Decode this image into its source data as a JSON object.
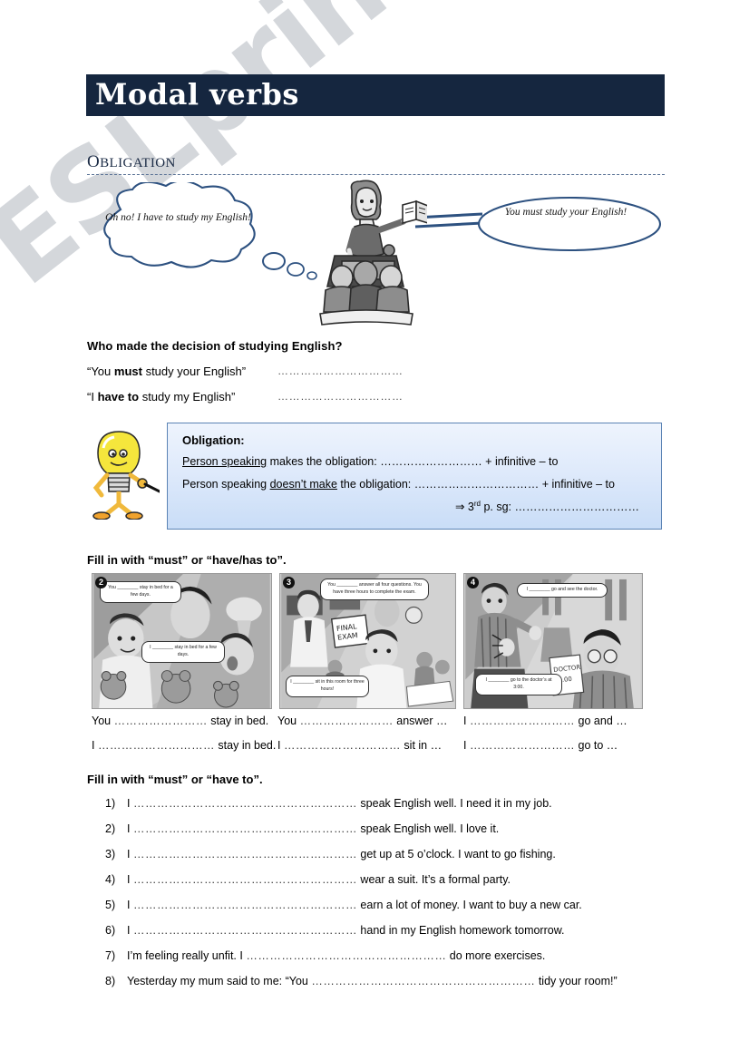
{
  "document": {
    "title": "Modal verbs",
    "watermark": "ESLprintables.com",
    "section_label_first": "O",
    "section_label_rest": "BLIGATION"
  },
  "illustration": {
    "thought_bubble": "Oh no! I have to study my English!",
    "speech_bubble": "You must study your English!",
    "teacher_icon": "teacher-with-book",
    "students_icon": "students-at-desk"
  },
  "question_block": {
    "heading": "Who made the decision of studying English?",
    "rows": [
      {
        "quote_pre": "“You ",
        "quote_bold": "must",
        "quote_post": " study your English”",
        "dots": "……………………………"
      },
      {
        "quote_pre": "“I ",
        "quote_bold": "have to",
        "quote_post": " study my English”",
        "dots": "……………………………"
      }
    ]
  },
  "obligation_box": {
    "icon": "lightbulb-character-with-pointer",
    "heading": "Obligation:",
    "line1_underline": "Person speaking",
    "line1_rest": " makes the obligation: ",
    "line1_dots": "………………………",
    "line1_tail": " + infinitive – to",
    "line2_pre": "Person speaking ",
    "line2_underline": "doesn’t make",
    "line2_rest": " the obligation: ",
    "line2_dots": "……………………………",
    "line2_tail": " + infinitive – to",
    "line3_arrow": "⇒ 3",
    "line3_sup": "rd",
    "line3_rest": " p. sg: ",
    "line3_dots": "……………………………"
  },
  "exercise_comics": {
    "instruction": "Fill in with “must” or “have/has to”.",
    "panels": [
      {
        "number": "2",
        "scene": "sick-child-in-bed",
        "bubble_top": "You ________ stay in bed for a few days.",
        "bubble_bottom": "I ________ stay in bed for a few days."
      },
      {
        "number": "3",
        "scene": "final-exam-classroom",
        "bubble_top": "You ________ answer all four questions. You have three hours to complete the exam.",
        "bubble_bottom": "I ________ sit in this room for three hours!"
      },
      {
        "number": "4",
        "scene": "man-with-backache",
        "bubble_top": "I ________ go and see the doctor.",
        "bubble_bottom": "I ________ go to the doctor’s at 3:00."
      }
    ],
    "answer_columns": [
      {
        "line1_pre": "You ",
        "line1_dots": "……………………",
        "line1_post": " stay in bed.",
        "line2_pre": "I ",
        "line2_dots": "…………………………",
        "line2_post": " stay in bed."
      },
      {
        "line1_pre": "You ",
        "line1_dots": "……………………",
        "line1_post": " answer …",
        "line2_pre": "I ",
        "line2_dots": "…………………………",
        "line2_post": " sit in …"
      },
      {
        "line1_pre": "I ",
        "line1_dots": "………………………",
        "line1_post": " go and …",
        "line2_pre": "I ",
        "line2_dots": "………………………",
        "line2_post": " go to …"
      }
    ]
  },
  "exercise_sentences": {
    "instruction": "Fill in with “must” or “have to”.",
    "items": [
      {
        "n": "1)",
        "pre": "I ",
        "dots": "…………………………………………………",
        "post": " speak English well. I need it in my job."
      },
      {
        "n": "2)",
        "pre": "I ",
        "dots": "…………………………………………………",
        "post": " speak English well. I love it."
      },
      {
        "n": "3)",
        "pre": "I ",
        "dots": "…………………………………………………",
        "post": " get up at 5 o’clock. I want to go fishing."
      },
      {
        "n": "4)",
        "pre": "I ",
        "dots": "…………………………………………………",
        "post": " wear a suit. It’s a formal party."
      },
      {
        "n": "5)",
        "pre": "I ",
        "dots": "…………………………………………………",
        "post": " earn a lot of money. I want to buy a new car."
      },
      {
        "n": "6)",
        "pre": "I ",
        "dots": "…………………………………………………",
        "post": " hand in my English homework tomorrow."
      },
      {
        "n": "7)",
        "pre": "I’m feeling really unfit. I ",
        "dots": "……………………………………………",
        "post": " do more exercises."
      },
      {
        "n": "8)",
        "pre": "Yesterday my mum said to me: “You ",
        "dots": "…………………………………………………",
        "post": " tidy your room!”"
      }
    ]
  },
  "colors": {
    "title_bar": "#15263f",
    "bubble_outline": "#2d5180",
    "box_border": "#5b83b5",
    "watermark": "#d2d5da"
  }
}
